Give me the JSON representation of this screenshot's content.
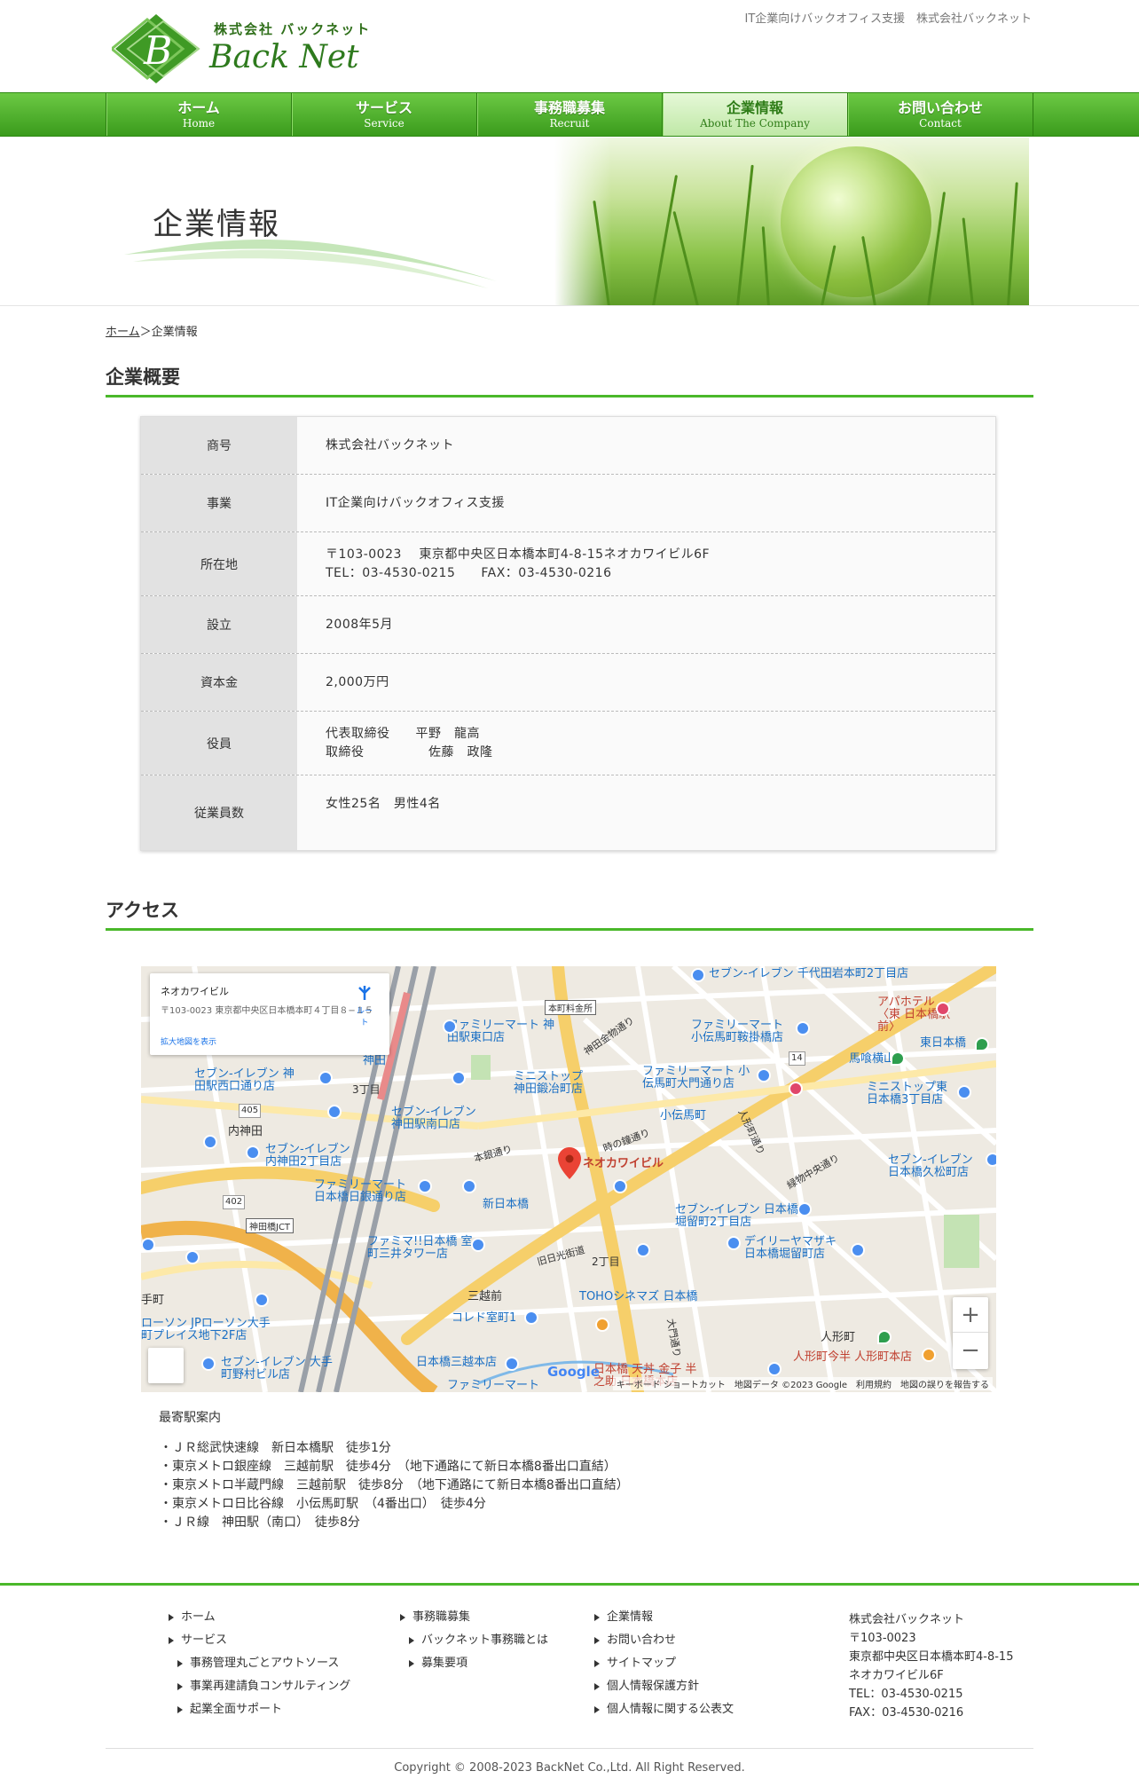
{
  "header": {
    "logo_kaisha": "株式会社 バックネット",
    "logo_name": "Back Net",
    "tagline": "IT企業向けバックオフィス支援　株式会社バックネット"
  },
  "nav": {
    "items": [
      {
        "jp": "ホーム",
        "en": "Home"
      },
      {
        "jp": "サービス",
        "en": "Service"
      },
      {
        "jp": "事務職募集",
        "en": "Recruit"
      },
      {
        "jp": "企業情報",
        "en": "About The Company"
      },
      {
        "jp": "お問い合わせ",
        "en": "Contact"
      }
    ],
    "active_index": 3
  },
  "hero": {
    "title": "企業情報"
  },
  "breadcrumb": {
    "home": "ホーム",
    "separator": "＞",
    "current": "企業情報"
  },
  "overview": {
    "heading": "企業概要",
    "rows": [
      {
        "label": "商号",
        "lines": [
          "株式会社バックネット"
        ]
      },
      {
        "label": "事業",
        "lines": [
          "IT企業向けバックオフィス支援"
        ]
      },
      {
        "label": "所在地",
        "lines": [
          "〒103-0023　 東京都中央区日本橋本町4-8-15ネオカワイビル6F",
          "TEL：03-4530-0215　　FAX：03-4530-0216"
        ]
      },
      {
        "label": "設立",
        "lines": [
          "2008年5月"
        ]
      },
      {
        "label": "資本金",
        "lines": [
          "2,000万円"
        ]
      },
      {
        "label": "役員",
        "lines": [
          "代表取締役　　平野　龍高",
          "取締役　　　　　佐藤　政隆"
        ]
      },
      {
        "label": "従業員数",
        "lines": [
          "女性25名　男性4名"
        ]
      }
    ]
  },
  "access": {
    "heading": "アクセス",
    "map": {
      "card_title": "ネオカワイビル",
      "card_address": "〒103-0023 東京都中央区日本橋本町４丁目８−１５",
      "card_link": "拡大地図を表示",
      "route_label": "ルート",
      "pin_label": "ネオカワイビル",
      "footer": "キーボード ショートカット　地図データ ©2023 Google　利用規約　地図の誤りを報告する",
      "zoom_in": "+",
      "zoom_out": "−",
      "google": "Google",
      "labels": [
        "セブン-イレブン 千代田岩本町2丁目店",
        "アパホテル〈東 日本橋駅前〉",
        "ファミリーマート 神田駅東口店",
        "ファミリーマート 小伝馬町鞍掛橋店",
        "東日本橋",
        "馬喰横山",
        "セブン-イレブン 神田駅西口通り店",
        "ミニストップ 神田鍛冶町店",
        "ファミリーマート 小伝馬町大門通り店",
        "ミニストップ東 日本橋3丁目店",
        "内神田",
        "小伝馬町",
        "セブン-イレブン 神田駅南口店",
        "セブン-イレブン 内神田2丁目店",
        "ファミリーマート 日本橋日銀通り店",
        "セブン-イレブン 日本橋久松町店",
        "新日本橋",
        "セブン-イレブン 日本橋堀留町2丁目店",
        "ファミマ!!日本橋 室町三井タワー店",
        "デイリーヤマザキ 日本橋堀留町店",
        "三越前",
        "TOHOシネマズ 日本橋",
        "コレド室町1",
        "人形町",
        "ローソン JPローソン大手 町プレイス地下2F店",
        "日本橋三越本店",
        "人形町今半 人形町本店",
        "セブン-イレブン 大手町野村ビル店",
        "日本橋 天丼 金子 半之助 日本橋本店",
        "ファミリーマート",
        "本町料金所",
        "神田橋JCT",
        "神田金物通り",
        "時の鐘通り",
        "人形町通り",
        "本銀通り",
        "旧日光街道",
        "2丁目",
        "3丁目",
        "大門通り",
        "緑物中央通り",
        "神田",
        "手町",
        "405",
        "402",
        "14"
      ]
    },
    "nearest_title": "最寄駅案内",
    "stations": [
      "・ＪＲ総武快速線　新日本橋駅　徒歩1分",
      "・東京メトロ銀座線　三越前駅　徒歩4分　（地下通路にて新日本橋8番出口直結）",
      "・東京メトロ半蔵門線　三越前駅　徒歩8分　（地下通路にて新日本橋8番出口直結）",
      "・東京メトロ日比谷線　小伝馬町駅　（4番出口）　徒歩4分",
      "・ＪＲ線　神田駅（南口）　徒歩8分"
    ]
  },
  "footer": {
    "col1": [
      {
        "label": "ホーム",
        "sub": false
      },
      {
        "label": "サービス",
        "sub": false
      },
      {
        "label": "事務管理丸ごとアウトソース",
        "sub": true
      },
      {
        "label": "事業再建請負コンサルティング",
        "sub": true
      },
      {
        "label": "起業全面サポート",
        "sub": true
      }
    ],
    "col2": [
      {
        "label": "事務職募集",
        "sub": false
      },
      {
        "label": "バックネット事務職とは",
        "sub": true
      },
      {
        "label": "募集要項",
        "sub": true
      }
    ],
    "col3": [
      {
        "label": "企業情報",
        "sub": false
      },
      {
        "label": "お問い合わせ",
        "sub": false
      },
      {
        "label": "サイトマップ",
        "sub": false
      },
      {
        "label": "個人情報保護方針",
        "sub": false
      },
      {
        "label": "個人情報に関する公表文",
        "sub": false
      }
    ],
    "address": [
      "株式会社バックネット",
      "〒103-0023",
      "東京都中央区日本橋本町4-8-15",
      "ネオカワイビル6F",
      "TEL：03-4530-0215",
      "FAX：03-4530-0216"
    ],
    "copyright": "Copyright © 2008-2023 BackNet Co.,Ltd. All Right Reserved."
  },
  "colors": {
    "accent_green": "#4ab82a",
    "nav_green": "#3a9b1c",
    "brand_dark_green": "#2e7a1d"
  }
}
